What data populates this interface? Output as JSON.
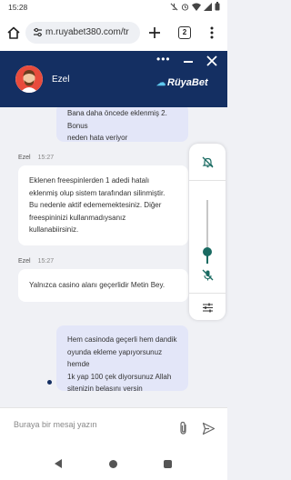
{
  "status_bar": {
    "time": "15:28",
    "icons": [
      "mute-icon",
      "alarm-icon",
      "wifi-icon",
      "signal-icon",
      "battery-icon"
    ]
  },
  "browser": {
    "url": "m.ruyabet380.com/tr",
    "tab_count": "2",
    "icons": [
      "home-icon",
      "site-settings-icon",
      "new-tab-icon",
      "more-menu-icon"
    ]
  },
  "chat_header": {
    "agent_name": "Ezel",
    "brand": "RüyaBet",
    "icons": [
      "more-options-icon",
      "minimize-icon",
      "close-icon"
    ]
  },
  "messages": [
    {
      "from": "user",
      "text_lines": [
        "Bana daha öncede eklenmiş 2. Bonus",
        "neden hata veriyor"
      ]
    },
    {
      "from": "agent",
      "name": "Ezel",
      "time": "15:27",
      "text_lines": [
        "Eklenen freespinlerden 1 adedi hatalı",
        "eklenmiş olup sistem tarafından silinmiştir.",
        "Bu nedenle aktif edememektesiniz. Diğer",
        "freespininizi kullanmadıysanız",
        "kullanabiirsiniz."
      ]
    },
    {
      "from": "agent",
      "name": "Ezel",
      "time": "15:27",
      "text_lines": [
        "Yalnızca casino alanı geçerlidir Metin Bey."
      ]
    },
    {
      "from": "user",
      "text_lines": [
        "Hem casinoda geçerli hem dandik",
        "oyunda ekleme yapıyorsunuz hemde",
        "1k yap 100 çek diyorsunuz Allah",
        "sitenizin belasını versin"
      ]
    }
  ],
  "overlay": {
    "icons": [
      "notifications-off-icon",
      "mic-off-icon",
      "tune-icon"
    ],
    "volume_level": 0.2
  },
  "composer": {
    "placeholder": "Buraya bir mesaj yazın",
    "icons": [
      "attach-icon",
      "send-icon"
    ]
  },
  "colors": {
    "header_bg": "#142f62",
    "user_bubble": "#e3e6f8",
    "agent_bubble": "#ffffff",
    "chat_bg": "#f0f1f5",
    "brand_accent": "#5ec8ef",
    "slider": "#1a6b62"
  }
}
